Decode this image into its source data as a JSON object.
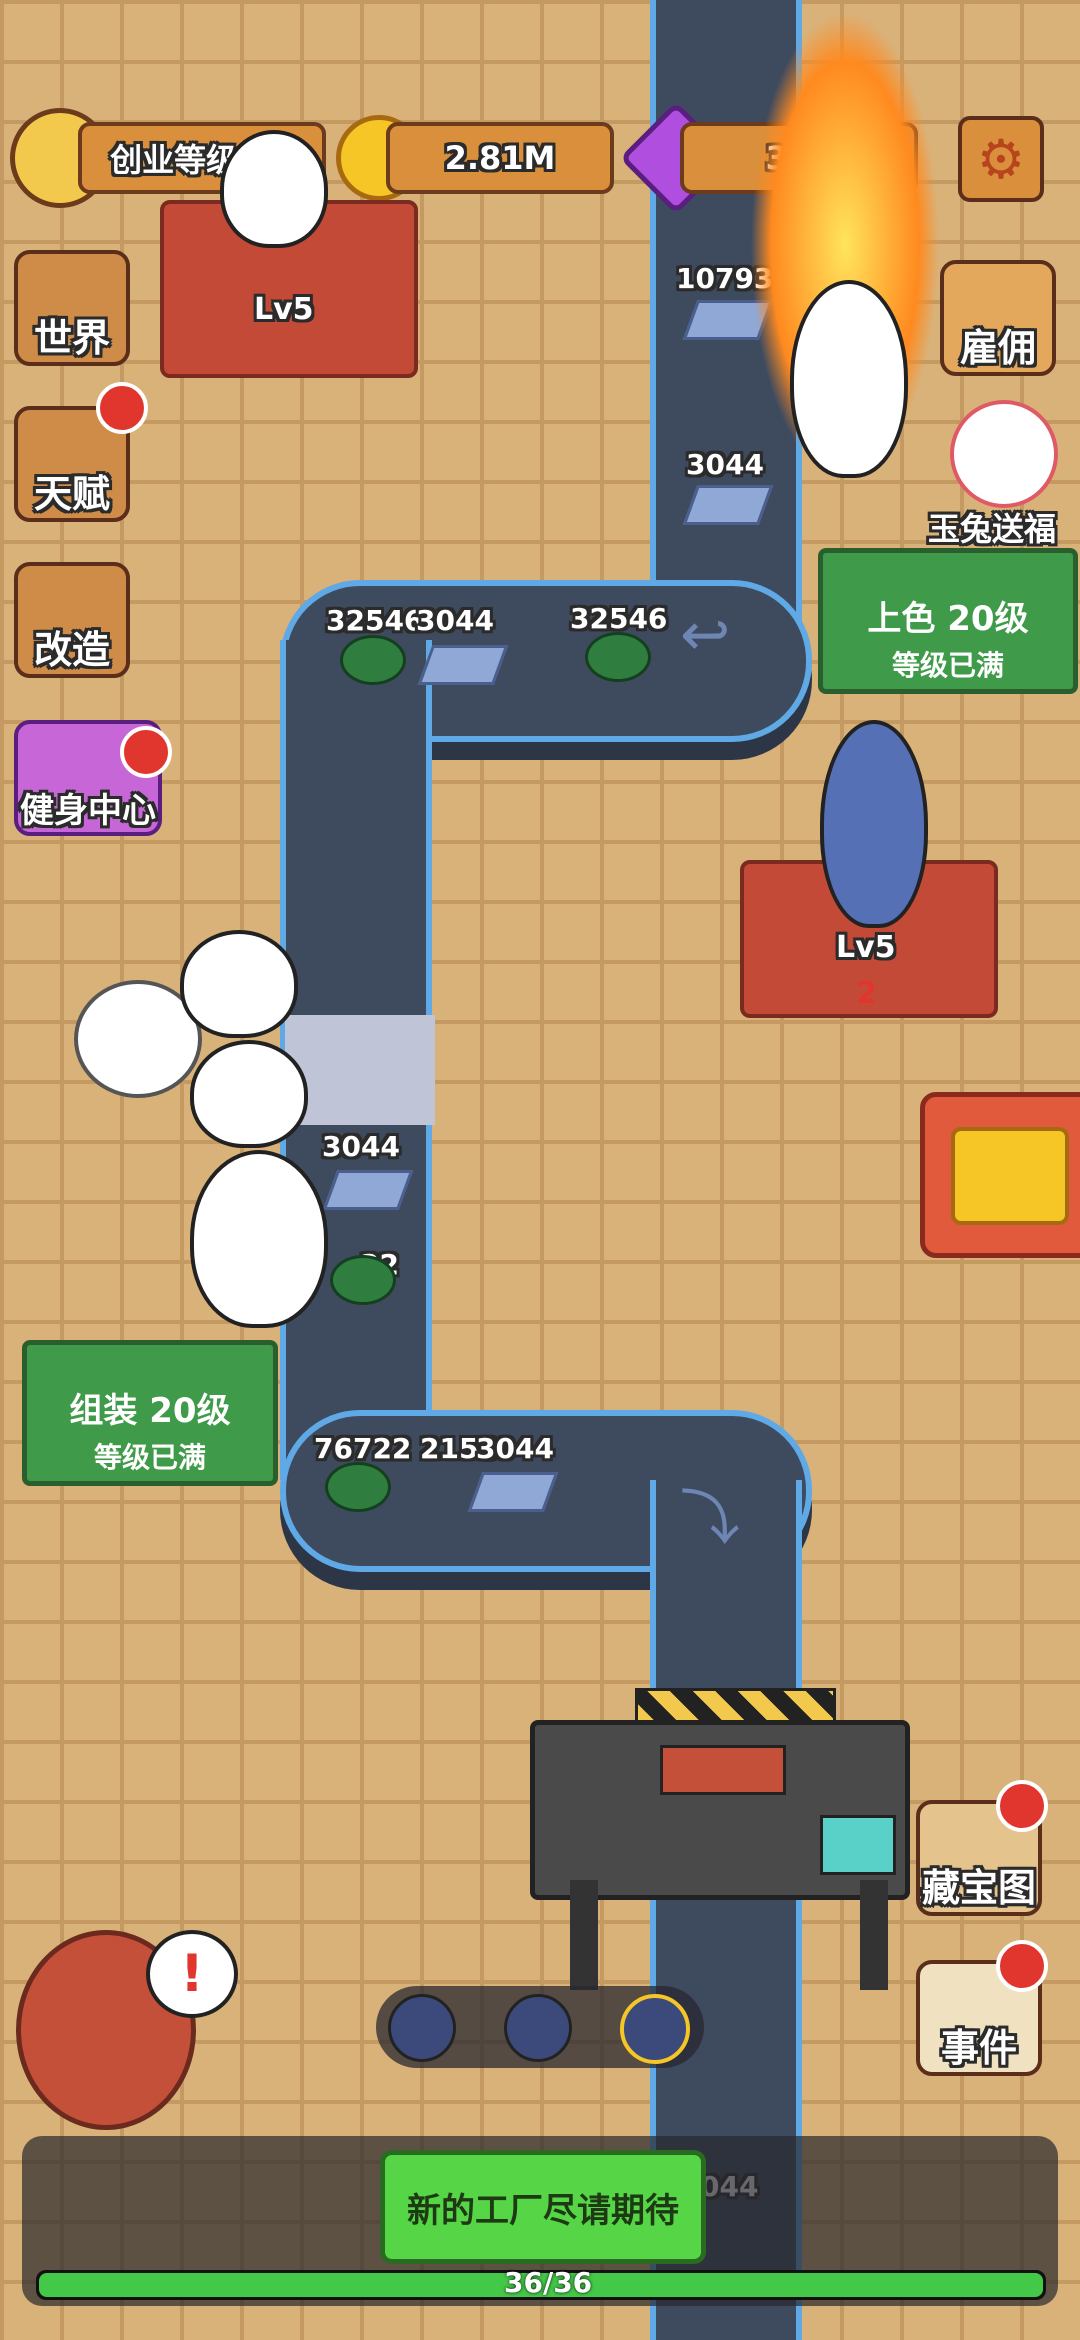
{
  "top_bar": {
    "level_label": "创业等级 20",
    "coins": "2.81M",
    "gems": "314"
  },
  "left_menu": [
    {
      "label": "世界",
      "icon": "map-icon"
    },
    {
      "label": "天赋",
      "icon": "talent-icon"
    },
    {
      "label": "改造",
      "icon": "paint-roller-icon"
    },
    {
      "label": "健身中心",
      "icon": "gym-icon"
    }
  ],
  "right_menu": {
    "hire": "雇佣",
    "jade_rabbit": "玉兔送福",
    "treasure_map": "藏宝图",
    "events": "事件"
  },
  "stations": {
    "top_station_level": "Lv5",
    "right_station_level": "Lv5",
    "right_station_count": "2"
  },
  "boards": {
    "color_board_title": "上色  20级",
    "color_board_status": "等级已满",
    "assemble_board_title": "组装  20级",
    "assemble_board_status": "等级已满"
  },
  "item_numbers": {
    "n1": "10793",
    "n2": "3044",
    "n3": "32546",
    "n4": "3044",
    "n5": "32546",
    "n6": "3044",
    "n7": "22",
    "n8": "76722",
    "n9": "2158",
    "n10": "3044",
    "n11": "044"
  },
  "bottom": {
    "banner": "新的工厂尽请期待",
    "progress_text": "36/36",
    "progress_value": 1.0
  },
  "colors": {
    "belt": "#3e4a5e",
    "belt_edge": "#5fa9e6",
    "board_green": "#3f9a49",
    "station_red": "#c44a38"
  }
}
